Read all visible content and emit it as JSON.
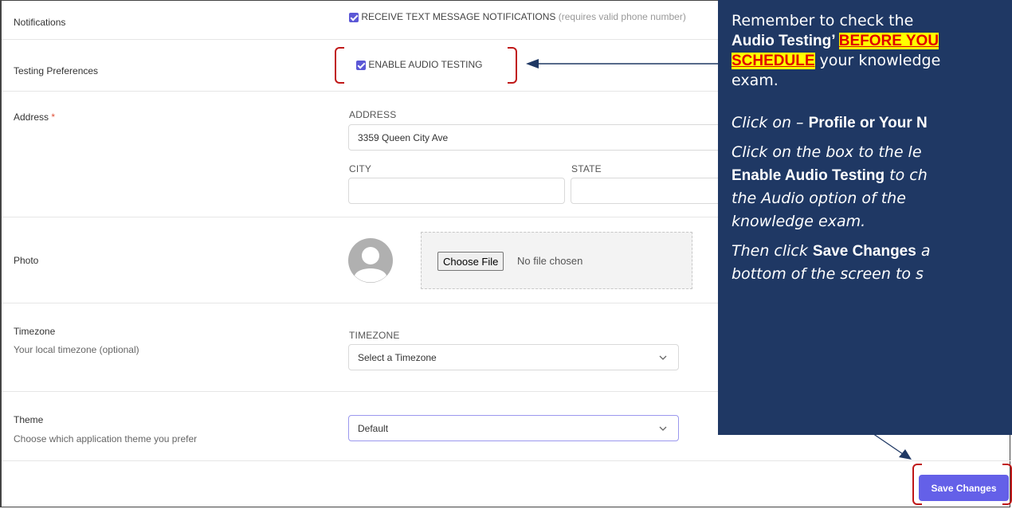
{
  "notifications": {
    "label": "Notifications",
    "sms_checkbox_label": "RECEIVE TEXT MESSAGE NOTIFICATIONS",
    "sms_note": "(requires valid phone number)"
  },
  "testing": {
    "label": "Testing Preferences",
    "audio_checkbox_label": "ENABLE AUDIO TESTING"
  },
  "address": {
    "label": "Address",
    "required_mark": "*",
    "address_caption": "ADDRESS",
    "address_value": "3359 Queen City Ave",
    "city_caption": "CITY",
    "city_value": "",
    "state_caption": "STATE",
    "state_value": ""
  },
  "photo": {
    "label": "Photo",
    "choose_file_label": "Choose File",
    "no_file_text": "No file chosen"
  },
  "timezone": {
    "label": "Timezone",
    "help": "Your local timezone (optional)",
    "caption": "TIMEZONE",
    "selected": "Select a Timezone"
  },
  "theme": {
    "label": "Theme",
    "help": "Choose which application theme you prefer",
    "selected": "Default"
  },
  "save_label": "Save Changes",
  "callout": {
    "line1": "Remember to check the",
    "line2_bold": "Audio Testing’ ",
    "line2_highlight": "BEFORE YOU",
    "line3_highlight": "SCHEDULE",
    "line3_rest": " your knowledge",
    "line4": "exam.",
    "line5_italic": "Click on – ",
    "line5_bold": "Profile or Your N",
    "line6_italic": "Click on the box to the le",
    "line7_bold": "Enable Audio Testing",
    "line7_italic": " to ch",
    "line8_italic": "the Audio option of the",
    "line9_italic": "knowledge exam.",
    "line10_italic": "Then click ",
    "line10_bold": "Save Changes",
    "line10_tail": " a",
    "line11_italic": "bottom of the screen to s"
  },
  "colors": {
    "accent": "#6460e8",
    "callout_bg": "#1f3864",
    "bracket": "#c01818",
    "highlight_bg": "#ffff00",
    "highlight_text": "#e00000"
  }
}
